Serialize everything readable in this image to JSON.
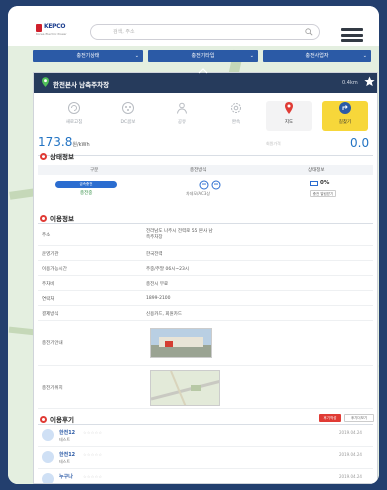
{
  "header": {
    "logo_text": "KEPCO",
    "logo_sub": "Korea Electric Power",
    "search_placeholder": "검색, 주소"
  },
  "filters": [
    {
      "label": "충전기상태"
    },
    {
      "label": "충전기타입"
    },
    {
      "label": "충전사업자"
    }
  ],
  "station": {
    "name": "한전본사 남측주차장",
    "distance": "0.4km",
    "tools": [
      {
        "icon": "refresh-icon",
        "label": "새로고침"
      },
      {
        "icon": "charger-icon",
        "label": "DC콤보"
      },
      {
        "icon": "person-icon",
        "label": "공유"
      },
      {
        "icon": "gear-icon",
        "label": "완속"
      },
      {
        "icon": "location-pin-icon",
        "label": "지도"
      },
      {
        "icon": "route-icon",
        "label": "길찾기"
      }
    ],
    "price": "173.8",
    "price_unit": "원/kWh",
    "price_mid": "회원가격",
    "price_right": "0.0"
  },
  "status": {
    "title": "상태정보",
    "columns": [
      "구분",
      "충전방식",
      "상태정보"
    ],
    "row": {
      "badge": "급속충전",
      "sub": "충전중",
      "connector_label": "차데모/AC3상",
      "percent": "0%",
      "button": "충전 알림받기"
    }
  },
  "usage": {
    "title": "이용정보",
    "rows": [
      {
        "key": "주소",
        "value": "전라남도 나주시 전력로 55 본사 남측주차장"
      },
      {
        "key": "운영기관",
        "value": "한국전력"
      },
      {
        "key": "이용가능시간",
        "value": "주중/주말 06시~23시"
      },
      {
        "key": "주차비",
        "value": "충전시 무료"
      },
      {
        "key": "연락처",
        "value": "1899-2100"
      },
      {
        "key": "결제방식",
        "value": "신용카드, 회원카드"
      },
      {
        "key": "충전기안내",
        "value": ""
      },
      {
        "key": "충전기위치",
        "value": ""
      }
    ]
  },
  "reviews": {
    "title": "이용후기",
    "write_button": "후기작성",
    "more_button": "후기더보기",
    "items": [
      {
        "name": "한전12",
        "stars": "☆☆☆☆☆",
        "text": "테스트",
        "date": "2019.04.24"
      },
      {
        "name": "한전12",
        "stars": "☆☆☆☆☆",
        "text": "테스트",
        "date": "2019.04.24"
      },
      {
        "name": "누구나",
        "stars": "☆☆☆☆☆",
        "text": "",
        "date": "2019.04.24"
      }
    ]
  },
  "colors": {
    "frame_bg": "#233f6e",
    "card_header": "#263b5c",
    "accent_blue": "#2273c3",
    "accent_red": "#e03b35",
    "accent_yellow": "#f7d73a"
  }
}
